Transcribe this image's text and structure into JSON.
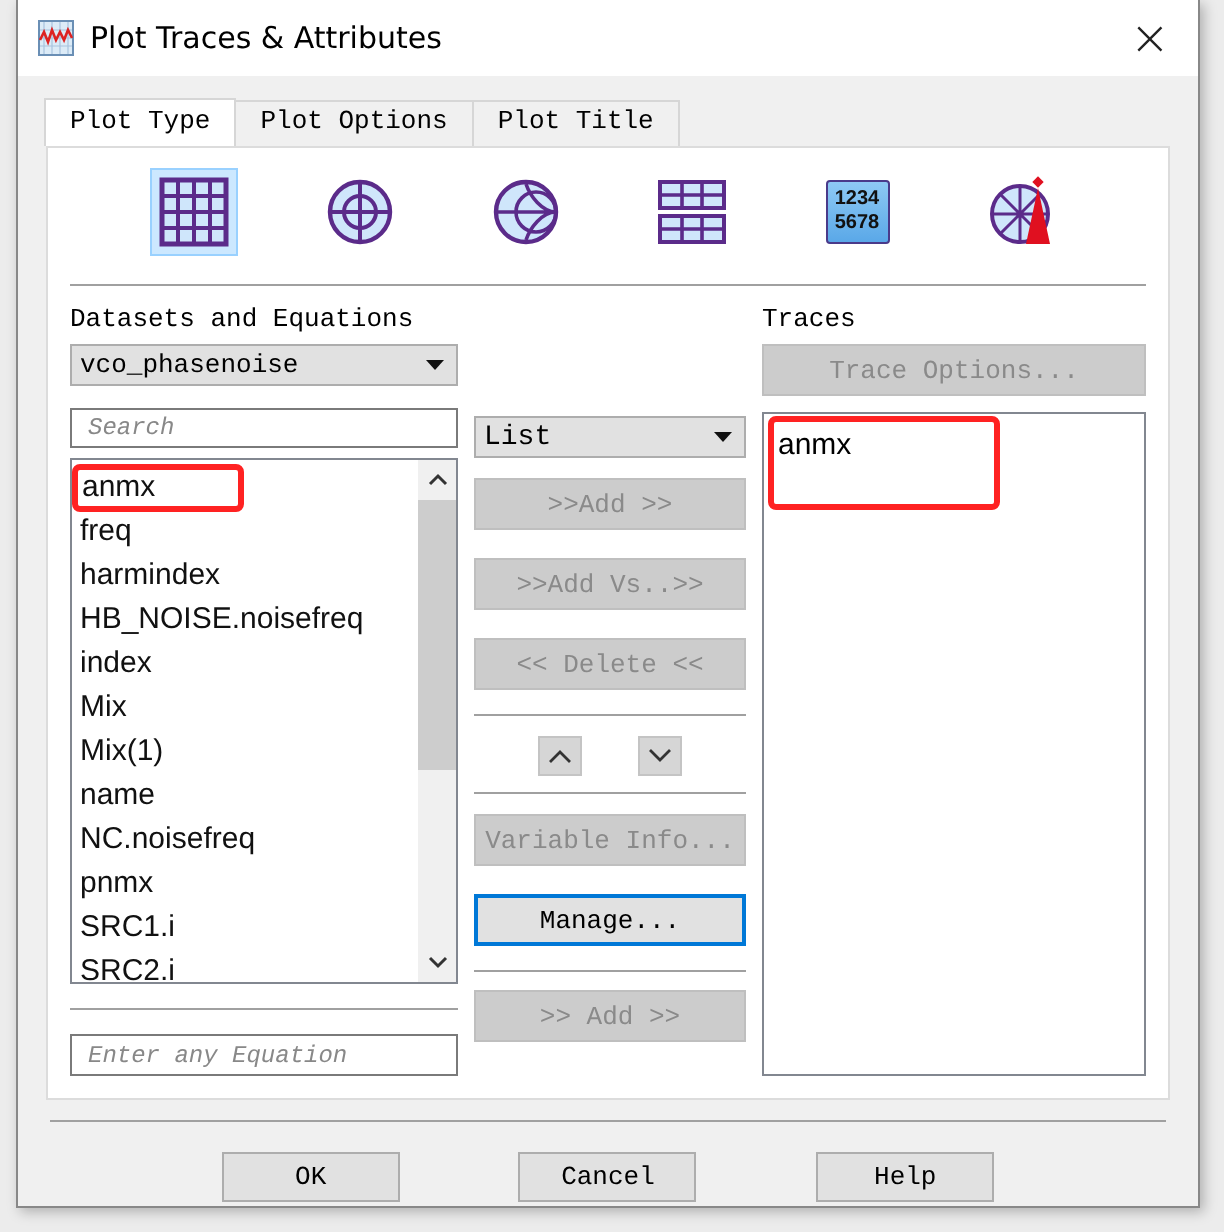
{
  "window": {
    "title": "Plot Traces & Attributes",
    "close": "×"
  },
  "tabs": [
    {
      "label": "Plot Type",
      "selected": true
    },
    {
      "label": "Plot Options",
      "selected": false
    },
    {
      "label": "Plot Title",
      "selected": false
    }
  ],
  "plot_types": [
    {
      "kind": "rectangular",
      "selected": true
    },
    {
      "kind": "polar",
      "selected": false
    },
    {
      "kind": "smith",
      "selected": false
    },
    {
      "kind": "list",
      "selected": false
    },
    {
      "kind": "data",
      "selected": false,
      "lines": [
        "1234",
        "5678"
      ]
    },
    {
      "kind": "antenna",
      "selected": false
    }
  ],
  "datasets": {
    "label": "Datasets and Equations",
    "dataset": "vco_phasenoise",
    "search_placeholder": "Search",
    "view": "List",
    "variables": [
      {
        "name": "anmx",
        "highlighted": true
      },
      {
        "name": "freq",
        "highlighted": false
      },
      {
        "name": "harmindex",
        "highlighted": false
      },
      {
        "name": "HB_NOISE.noisefreq",
        "highlighted": false
      },
      {
        "name": "index",
        "highlighted": false
      },
      {
        "name": "Mix",
        "highlighted": false
      },
      {
        "name": "Mix(1)",
        "highlighted": false
      },
      {
        "name": "name",
        "highlighted": false
      },
      {
        "name": "NC.noisefreq",
        "highlighted": false
      },
      {
        "name": "pnmx",
        "highlighted": false
      },
      {
        "name": "SRC1.i",
        "highlighted": false
      },
      {
        "name": "SRC2.i",
        "highlighted": false
      }
    ],
    "equation_placeholder": "Enter any Equation"
  },
  "actions": [
    {
      "label": ">>Add >>",
      "disabled": true
    },
    {
      "label": ">>Add Vs..>>",
      "disabled": true
    },
    {
      "label": "<< Delete <<",
      "disabled": true
    }
  ],
  "info_buttons": [
    {
      "label": "Variable Info...",
      "disabled": true,
      "focused": false
    },
    {
      "label": "Manage...",
      "disabled": false,
      "focused": true
    }
  ],
  "equation_add": {
    "label": ">> Add >>",
    "disabled": true
  },
  "traces": {
    "label": "Traces",
    "options_button": {
      "label": "Trace Options...",
      "disabled": true
    },
    "items": [
      {
        "name": "anmx",
        "highlighted": true
      }
    ]
  },
  "buttons": [
    "OK",
    "Cancel",
    "Help"
  ]
}
